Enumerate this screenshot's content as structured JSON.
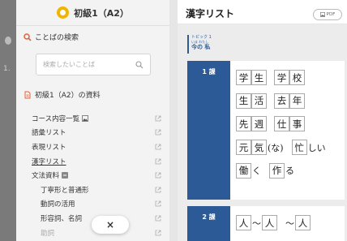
{
  "drawer": {
    "title": "初級1（A2）",
    "search_section": "ことばの検索",
    "search_placeholder": "検索したいことば",
    "docs_section": "初級1（A2）の資料",
    "items": [
      {
        "label": "コース内容一覧",
        "icon": "image-icon",
        "indent": false
      },
      {
        "label": "語彙リスト",
        "indent": false
      },
      {
        "label": "表現リスト",
        "indent": false
      },
      {
        "label": "漢字リスト",
        "indent": false,
        "active": true
      },
      {
        "label": "文法資料",
        "indent": false,
        "collapse": true
      },
      {
        "label": "丁寧形と普通形",
        "indent": true
      },
      {
        "label": "動詞の活用",
        "indent": true
      },
      {
        "label": "形容詞、名詞",
        "indent": true
      },
      {
        "label": "助詞",
        "indent": true
      }
    ],
    "close_label": "×"
  },
  "page": {
    "title": "漢字リスト",
    "pdf_label": "PDF",
    "topic": {
      "label": "トピック 1",
      "ruby": "いま わたし",
      "name": "今の 私"
    },
    "lessons": [
      {
        "label": "1 課"
      },
      {
        "label": "2 課"
      }
    ],
    "lesson1_rows": [
      [
        [
          "k",
          "学"
        ],
        [
          "k",
          "生"
        ],
        [
          "g"
        ],
        [
          "k",
          "学"
        ],
        [
          "k",
          "校"
        ]
      ],
      [
        [
          "k",
          "生"
        ],
        [
          "k",
          "活"
        ],
        [
          "g"
        ],
        [
          "k",
          "去"
        ],
        [
          "k",
          "年"
        ]
      ],
      [
        [
          "k",
          "先"
        ],
        [
          "k",
          "週"
        ],
        [
          "g"
        ],
        [
          "k",
          "仕"
        ],
        [
          "k",
          "事"
        ]
      ],
      [
        [
          "k",
          "元"
        ],
        [
          "k",
          "気"
        ],
        [
          "t",
          "(な)"
        ],
        [
          "g"
        ],
        [
          "k",
          "忙"
        ],
        [
          "t",
          "しい"
        ]
      ],
      [
        [
          "k",
          "働"
        ],
        [
          "t",
          "く"
        ],
        [
          "g"
        ],
        [
          "k",
          "作"
        ],
        [
          "t",
          "る"
        ]
      ]
    ],
    "lesson2_rows": [
      [
        [
          "k",
          "人"
        ],
        [
          "t",
          "〜"
        ],
        [
          "k",
          "人"
        ],
        [
          "g"
        ],
        [
          "t",
          "〜"
        ],
        [
          "k",
          "人"
        ]
      ]
    ]
  },
  "colors": {
    "accent": "#2c5a96",
    "brand": "#f2b400",
    "search_icon": "#e0623b"
  }
}
